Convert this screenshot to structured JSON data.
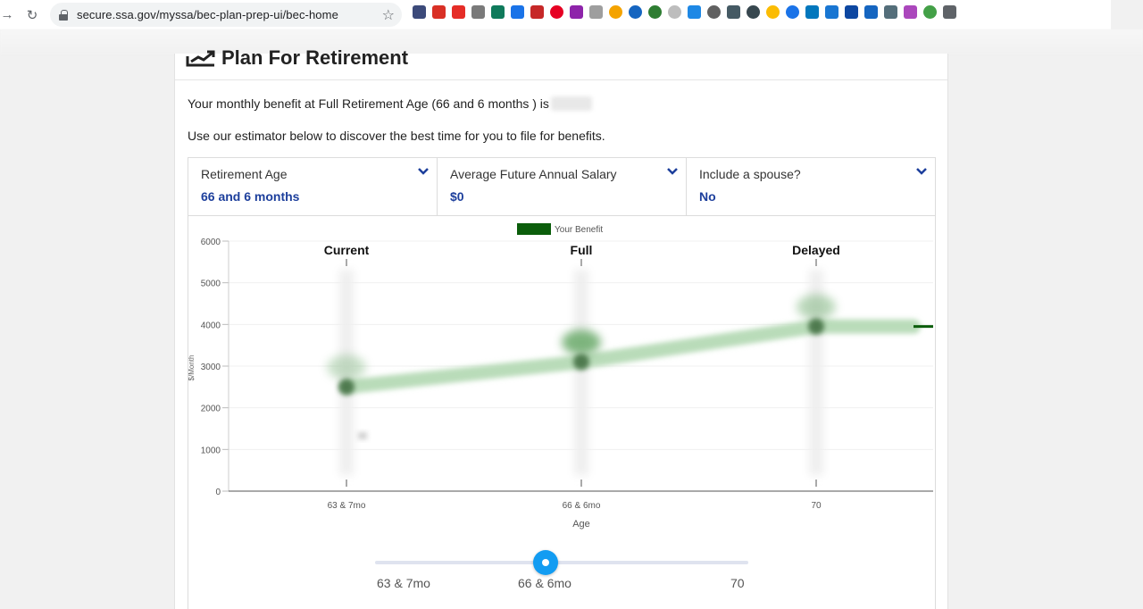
{
  "browser": {
    "url": "secure.ssa.gov/myssa/bec-plan-prep-ui/bec-home"
  },
  "page": {
    "title": "Plan For Retirement",
    "benefit_text": "Your monthly benefit at Full Retirement Age (66 and 6 months ) is",
    "intro_text": "Use our estimator below to discover the best time for you to file for benefits."
  },
  "controls": [
    {
      "label": "Retirement Age",
      "value": "66 and 6 months"
    },
    {
      "label": "Average Future Annual Salary",
      "value": "$0"
    },
    {
      "label": "Include a spouse?",
      "value": "No"
    }
  ],
  "colors": {
    "accent_blue": "#1d3f9c",
    "benefit_green": "#0b5d0b",
    "slider_blue": "#129cf2"
  },
  "chart_data": {
    "type": "line",
    "legend": [
      "Your Benefit"
    ],
    "legend_position": "top",
    "y_label": "$/Month",
    "x_label": "Age",
    "ylim": [
      0,
      6000
    ],
    "y_ticks": [
      0,
      1000,
      2000,
      3000,
      4000,
      5000,
      6000
    ],
    "x_ticks": [
      "63 & 7mo",
      "66 & 6mo",
      "70"
    ],
    "markers": [
      "Current",
      "Full",
      "Delayed"
    ],
    "series": [
      {
        "name": "Your Benefit",
        "x": [
          "63 & 7mo",
          "66 & 6mo",
          "70"
        ],
        "values": [
          2500,
          3100,
          3950
        ]
      }
    ],
    "grid": true
  },
  "slider": {
    "labels": [
      "63 & 7mo",
      "66 & 6mo",
      "70"
    ],
    "selected": "66 & 6mo"
  }
}
